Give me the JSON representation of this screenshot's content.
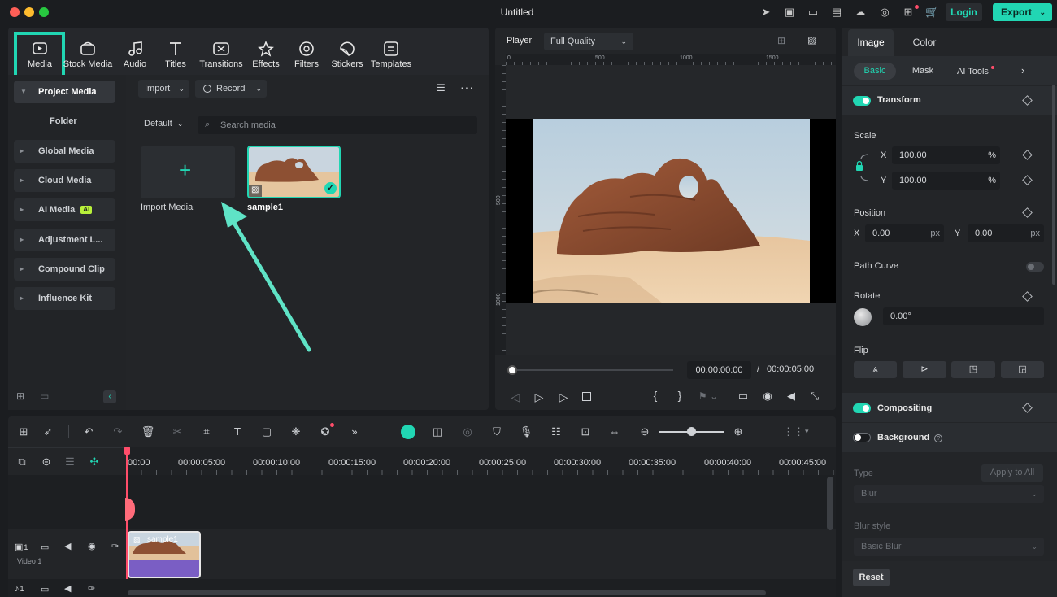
{
  "window": {
    "title": "Untitled"
  },
  "header": {
    "login_label": "Login",
    "export_label": "Export"
  },
  "media_toolbar": {
    "items": [
      {
        "label": "Media",
        "icon": "media-icon"
      },
      {
        "label": "Stock Media",
        "icon": "stock-media-icon"
      },
      {
        "label": "Audio",
        "icon": "audio-icon"
      },
      {
        "label": "Titles",
        "icon": "titles-icon"
      },
      {
        "label": "Transitions",
        "icon": "transitions-icon"
      },
      {
        "label": "Effects",
        "icon": "effects-icon"
      },
      {
        "label": "Filters",
        "icon": "filters-icon"
      },
      {
        "label": "Stickers",
        "icon": "stickers-icon"
      },
      {
        "label": "Templates",
        "icon": "templates-icon"
      }
    ]
  },
  "sidebar": {
    "project_media": "Project Media",
    "folder": "Folder",
    "items": [
      "Global Media",
      "Cloud Media",
      "AI Media",
      "Adjustment L...",
      "Compound Clip",
      "Influence Kit"
    ],
    "ai_badge": "AI"
  },
  "media_panel": {
    "import_label": "Import",
    "record_label": "Record",
    "sort_label": "Default",
    "search_placeholder": "Search media",
    "import_media_label": "Import Media",
    "clip_name": "sample1"
  },
  "player": {
    "label": "Player",
    "quality": "Full Quality",
    "ruler_ticks": [
      "0",
      "500",
      "1000",
      "1500"
    ],
    "vruler_ticks": [
      "500",
      "1000"
    ],
    "current_time": "00:00:00:00",
    "separator": "/",
    "total_time": "00:00:05:00"
  },
  "inspector": {
    "tabs": [
      "Image",
      "Color"
    ],
    "subtabs": [
      "Basic",
      "Mask",
      "AI Tools"
    ],
    "transform": "Transform",
    "scale": {
      "label": "Scale",
      "x_label": "X",
      "x": "100.00",
      "y_label": "Y",
      "y": "100.00",
      "unit": "%"
    },
    "position": {
      "label": "Position",
      "x_label": "X",
      "x": "0.00",
      "y_label": "Y",
      "y": "0.00",
      "unit": "px"
    },
    "path_curve": "Path Curve",
    "rotate": {
      "label": "Rotate",
      "value": "0.00°"
    },
    "flip": "Flip",
    "compositing": "Compositing",
    "background": "Background",
    "type": {
      "label": "Type",
      "value": "Blur",
      "apply_all": "Apply to All"
    },
    "blur_style": {
      "label": "Blur style",
      "value": "Basic Blur"
    },
    "reset_label": "Reset"
  },
  "timeline": {
    "times": [
      "00:00",
      "00:00:05:00",
      "00:00:10:00",
      "00:00:15:00",
      "00:00:20:00",
      "00:00:25:00",
      "00:00:30:00",
      "00:00:35:00",
      "00:00:40:00",
      "00:00:45:00"
    ],
    "track_label": "Video 1",
    "track_number": "1",
    "track_number_2": "1",
    "clip_label": "sample1"
  },
  "colors": {
    "accent": "#21d6b3",
    "panel": "#232528",
    "bg": "#1b1d20"
  }
}
